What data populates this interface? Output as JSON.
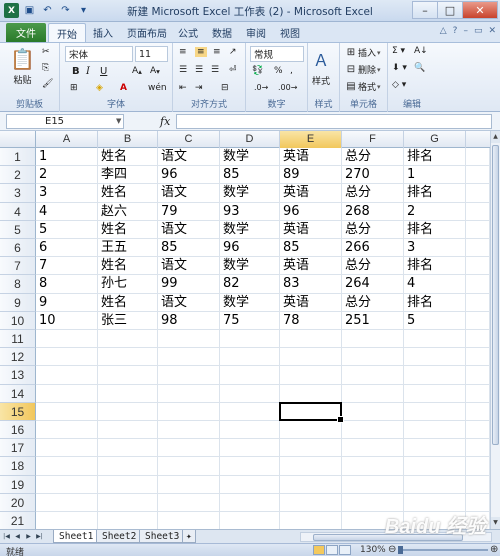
{
  "window": {
    "title": "新建 Microsoft Excel 工作表 (2) - Microsoft Excel",
    "controls": [
      "–",
      "□",
      "✕"
    ]
  },
  "quick_access": [
    "excel-logo-icon",
    "save-icon",
    "undo-icon",
    "redo-icon"
  ],
  "ribbon": {
    "file_tab": "文件",
    "tabs": [
      "开始",
      "插入",
      "页面布局",
      "公式",
      "数据",
      "审阅",
      "视图"
    ],
    "active_tab": "开始",
    "groups": {
      "clipboard": {
        "label": "剪贴板",
        "paste": "粘贴"
      },
      "font": {
        "label": "字体",
        "font_name": "宋体",
        "font_size": "11",
        "bold": "B",
        "italic": "I",
        "underline": "U"
      },
      "alignment": {
        "label": "对齐方式"
      },
      "number": {
        "label": "数字",
        "format": "常规"
      },
      "styles": {
        "label": "样式",
        "button": "样式"
      },
      "cells": {
        "label": "单元格",
        "insert": "插入",
        "delete": "删除",
        "format": "格式"
      },
      "editing": {
        "label": "编辑"
      }
    }
  },
  "formula_bar": {
    "name_box": "E15",
    "fx": "fx",
    "value": ""
  },
  "grid": {
    "columns": [
      "A",
      "B",
      "C",
      "D",
      "E",
      "F",
      "G"
    ],
    "selected_column": "E",
    "rows": [
      "1",
      "2",
      "3",
      "4",
      "5",
      "6",
      "7",
      "8",
      "9",
      "10",
      "11",
      "12",
      "13",
      "14",
      "15",
      "16",
      "17",
      "18",
      "19",
      "20",
      "21"
    ],
    "selected_row": "15",
    "active_cell": "E15",
    "cells": [
      [
        "1",
        "姓名",
        "语文",
        "数学",
        "英语",
        "总分",
        "排名"
      ],
      [
        "2",
        "李四",
        "96",
        "85",
        "89",
        "270",
        "1"
      ],
      [
        "3",
        "姓名",
        "语文",
        "数学",
        "英语",
        "总分",
        "排名"
      ],
      [
        "4",
        "赵六",
        "79",
        "93",
        "96",
        "268",
        "2"
      ],
      [
        "5",
        "姓名",
        "语文",
        "数学",
        "英语",
        "总分",
        "排名"
      ],
      [
        "6",
        "王五",
        "85",
        "96",
        "85",
        "266",
        "3"
      ],
      [
        "7",
        "姓名",
        "语文",
        "数学",
        "英语",
        "总分",
        "排名"
      ],
      [
        "8",
        "孙七",
        "99",
        "82",
        "83",
        "264",
        "4"
      ],
      [
        "9",
        "姓名",
        "语文",
        "数学",
        "英语",
        "总分",
        "排名"
      ],
      [
        "10",
        "张三",
        "98",
        "75",
        "78",
        "251",
        "5"
      ]
    ]
  },
  "sheets": {
    "tabs": [
      "Sheet1",
      "Sheet2",
      "Sheet3"
    ],
    "active": "Sheet1"
  },
  "status": {
    "text": "就绪",
    "zoom": "130%"
  },
  "watermark": "Baidu 经验"
}
